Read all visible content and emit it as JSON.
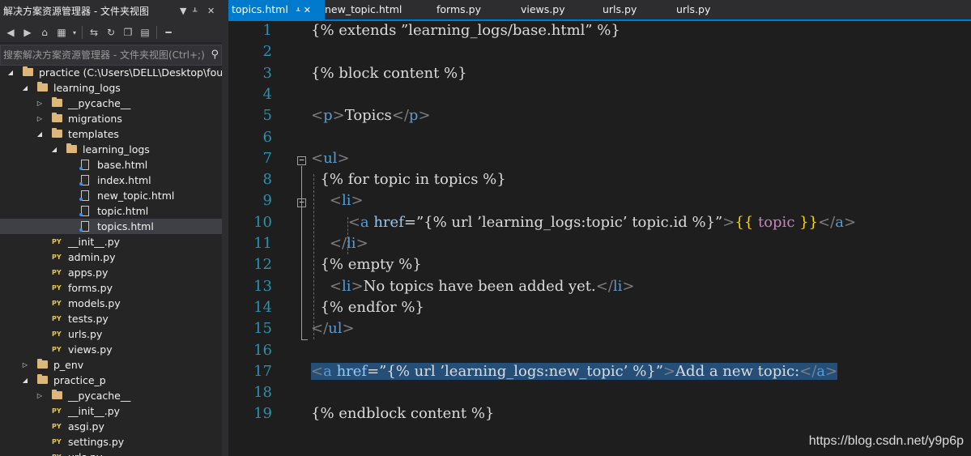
{
  "explorer": {
    "title": "解决方案资源管理器 - 文件夹视图",
    "controls": {
      "dropdown": "▼",
      "pin": "ᚆ",
      "close": "✕"
    },
    "toolbar_icons": [
      "back-icon",
      "forward-icon",
      "home-icon",
      "switch-views-icon",
      "dropdown-icon",
      "sync-icon",
      "refresh-icon",
      "collapse-all-icon",
      "show-all-files-icon",
      "properties-icon"
    ],
    "search_placeholder": "搜索解决方案资源管理器 - 文件夹视图(Ctrl+;)",
    "tree": [
      {
        "label": "practice (C:\\Users\\DELL\\Desktop\\four\\",
        "type": "project",
        "depth": 0,
        "expanded": true
      },
      {
        "label": "learning_logs",
        "type": "folder",
        "depth": 1,
        "expanded": true
      },
      {
        "label": "__pycache__",
        "type": "folder",
        "depth": 2,
        "expanded": false
      },
      {
        "label": "migrations",
        "type": "folder",
        "depth": 2,
        "expanded": false
      },
      {
        "label": "templates",
        "type": "folder",
        "depth": 2,
        "expanded": true
      },
      {
        "label": "learning_logs",
        "type": "folder",
        "depth": 3,
        "expanded": true
      },
      {
        "label": "base.html",
        "type": "html",
        "depth": 4
      },
      {
        "label": "index.html",
        "type": "html",
        "depth": 4
      },
      {
        "label": "new_topic.html",
        "type": "html",
        "depth": 4
      },
      {
        "label": "topic.html",
        "type": "html",
        "depth": 4
      },
      {
        "label": "topics.html",
        "type": "html",
        "depth": 4,
        "selected": true
      },
      {
        "label": "__init__.py",
        "type": "py",
        "depth": 2
      },
      {
        "label": "admin.py",
        "type": "py",
        "depth": 2
      },
      {
        "label": "apps.py",
        "type": "py",
        "depth": 2
      },
      {
        "label": "forms.py",
        "type": "py",
        "depth": 2
      },
      {
        "label": "models.py",
        "type": "py",
        "depth": 2
      },
      {
        "label": "tests.py",
        "type": "py",
        "depth": 2
      },
      {
        "label": "urls.py",
        "type": "py",
        "depth": 2
      },
      {
        "label": "views.py",
        "type": "py",
        "depth": 2
      },
      {
        "label": "p_env",
        "type": "folder",
        "depth": 1,
        "expanded": false
      },
      {
        "label": "practice_p",
        "type": "folder",
        "depth": 1,
        "expanded": true
      },
      {
        "label": "__pycache__",
        "type": "folder",
        "depth": 2,
        "expanded": false
      },
      {
        "label": "__init__.py",
        "type": "py",
        "depth": 2
      },
      {
        "label": "asgi.py",
        "type": "py",
        "depth": 2
      },
      {
        "label": "settings.py",
        "type": "py",
        "depth": 2
      },
      {
        "label": "urls.py",
        "type": "py",
        "depth": 2
      }
    ]
  },
  "tabs": [
    {
      "label": "topics.html",
      "active": true,
      "pin": "ᚆ",
      "close": "✕"
    },
    {
      "label": "new_topic.html"
    },
    {
      "label": "forms.py"
    },
    {
      "label": "views.py"
    },
    {
      "label": "urls.py"
    },
    {
      "label": "urls.py"
    }
  ],
  "editor": {
    "lines": [
      {
        "n": "1",
        "segs": [
          [
            "t",
            "{% extends ”learning_logs/base.html” %}"
          ]
        ]
      },
      {
        "n": "2",
        "segs": []
      },
      {
        "n": "3",
        "segs": [
          [
            "t",
            "{% block content %}"
          ]
        ]
      },
      {
        "n": "4",
        "segs": []
      },
      {
        "n": "5",
        "segs": [
          [
            "tag",
            "<"
          ],
          [
            "nm",
            "p"
          ],
          [
            "tag",
            ">"
          ],
          [
            "t",
            "Topics"
          ],
          [
            "tag",
            "</"
          ],
          [
            "nm",
            "p"
          ],
          [
            "tag",
            ">"
          ]
        ]
      },
      {
        "n": "6",
        "segs": []
      },
      {
        "n": "7",
        "segs": [
          [
            "tag",
            "<"
          ],
          [
            "nm",
            "ul"
          ],
          [
            "tag",
            ">"
          ]
        ]
      },
      {
        "n": "8",
        "segs": [
          [
            "t",
            "  {% for topic in topics %}"
          ]
        ]
      },
      {
        "n": "9",
        "segs": [
          [
            "t",
            "    "
          ],
          [
            "tag",
            "<"
          ],
          [
            "nm",
            "li"
          ],
          [
            "tag",
            ">"
          ]
        ]
      },
      {
        "n": "10",
        "segs": [
          [
            "t",
            "        "
          ],
          [
            "tag",
            "<"
          ],
          [
            "nm",
            "a"
          ],
          [
            "t",
            " "
          ],
          [
            "attr",
            "href"
          ],
          [
            "t",
            "=”{% url ’learning_logs:topic’ topic.id %}”"
          ],
          [
            "tag",
            ">"
          ],
          [
            "br",
            "{{ "
          ],
          [
            "mag2",
            "topic"
          ],
          [
            "br",
            " }}"
          ],
          [
            "tag",
            "</"
          ],
          [
            "nm",
            "a"
          ],
          [
            "tag",
            ">"
          ]
        ]
      },
      {
        "n": "11",
        "segs": [
          [
            "t",
            "    "
          ],
          [
            "tag",
            "</"
          ],
          [
            "nm",
            "li"
          ],
          [
            "tag",
            ">"
          ]
        ]
      },
      {
        "n": "12",
        "segs": [
          [
            "t",
            "  {% empty %}"
          ]
        ]
      },
      {
        "n": "13",
        "segs": [
          [
            "t",
            "    "
          ],
          [
            "tag",
            "<"
          ],
          [
            "nm",
            "li"
          ],
          [
            "tag",
            ">"
          ],
          [
            "t",
            "No topics have been added yet."
          ],
          [
            "tag",
            "</"
          ],
          [
            "nm",
            "li"
          ],
          [
            "tag",
            ">"
          ]
        ]
      },
      {
        "n": "14",
        "segs": [
          [
            "t",
            "  {% endfor %}"
          ]
        ]
      },
      {
        "n": "15",
        "segs": [
          [
            "tag",
            "</"
          ],
          [
            "nm",
            "ul"
          ],
          [
            "tag",
            ">"
          ]
        ]
      },
      {
        "n": "16",
        "segs": []
      },
      {
        "n": "17",
        "highlight": true,
        "segs": [
          [
            "tag",
            "<"
          ],
          [
            "nm",
            "a"
          ],
          [
            "t",
            " "
          ],
          [
            "attr",
            "href"
          ],
          [
            "t",
            "=”{% url ’learning_logs:new_topic’ %}”"
          ],
          [
            "tag",
            ">"
          ],
          [
            "t",
            "Add a new topic:"
          ],
          [
            "tag",
            "</"
          ],
          [
            "nm",
            "a"
          ],
          [
            "tag",
            ">"
          ]
        ]
      },
      {
        "n": "18",
        "segs": []
      },
      {
        "n": "19",
        "segs": [
          [
            "t",
            "{% endblock content %}"
          ]
        ]
      }
    ]
  },
  "watermark": "https://blog.csdn.net/y9p6p",
  "colors": {
    "accent": "#007acc",
    "folder": "#dcb67a",
    "keyword": "#569cd6",
    "tag": "#808080",
    "line_number": "#2b91af",
    "highlight": "#264f78"
  }
}
